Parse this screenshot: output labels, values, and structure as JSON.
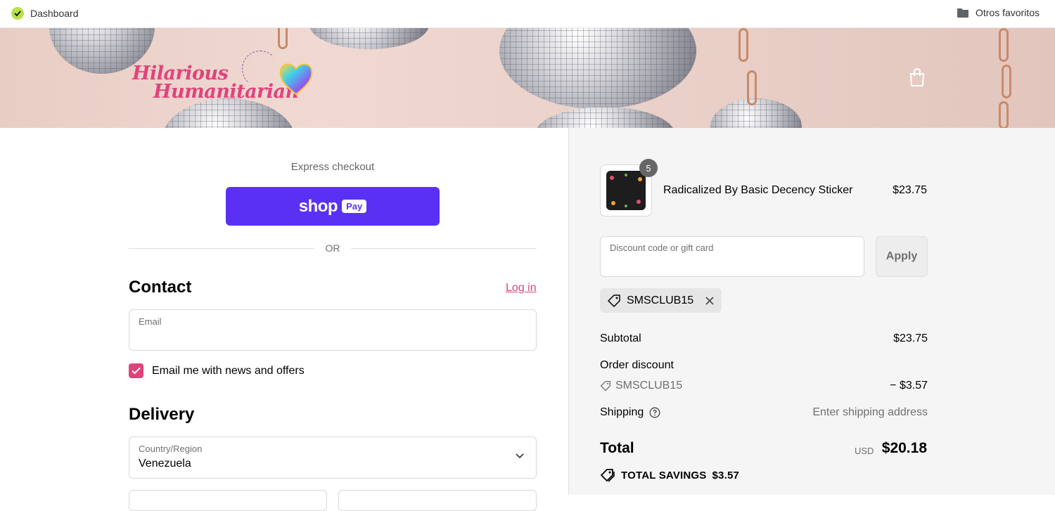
{
  "bookmarks": {
    "left_label": "Dashboard",
    "right_label": "Otros favoritos"
  },
  "header": {
    "logo_line1": "Hilarious",
    "logo_line2": "Humanitarian"
  },
  "checkout": {
    "express_label": "Express checkout",
    "shoppay_word": "shop",
    "shoppay_chip": "Pay",
    "or_label": "OR",
    "contact_heading": "Contact",
    "login_label": "Log in",
    "email_label": "Email",
    "email_value": "",
    "newsletter_label": "Email me with news and offers",
    "newsletter_checked": true,
    "delivery_heading": "Delivery",
    "country_label": "Country/Region",
    "country_value": "Venezuela"
  },
  "summary": {
    "item": {
      "name": "Radicalized By Basic Decency Sticker",
      "price": "$23.75",
      "quantity": "5"
    },
    "discount_placeholder": "Discount code or gift card",
    "apply_label": "Apply",
    "applied_code": "SMSCLUB15",
    "subtotal_label": "Subtotal",
    "subtotal_value": "$23.75",
    "order_discount_label": "Order discount",
    "order_discount_code": "SMSCLUB15",
    "order_discount_value": "− $3.57",
    "shipping_label": "Shipping",
    "shipping_value": "Enter shipping address",
    "total_label": "Total",
    "total_currency": "USD",
    "total_value": "$20.18",
    "savings_label": "TOTAL SAVINGS",
    "savings_value": "$3.57"
  },
  "colors": {
    "accent": "#e2427c",
    "shoppay": "#5a31f4"
  }
}
